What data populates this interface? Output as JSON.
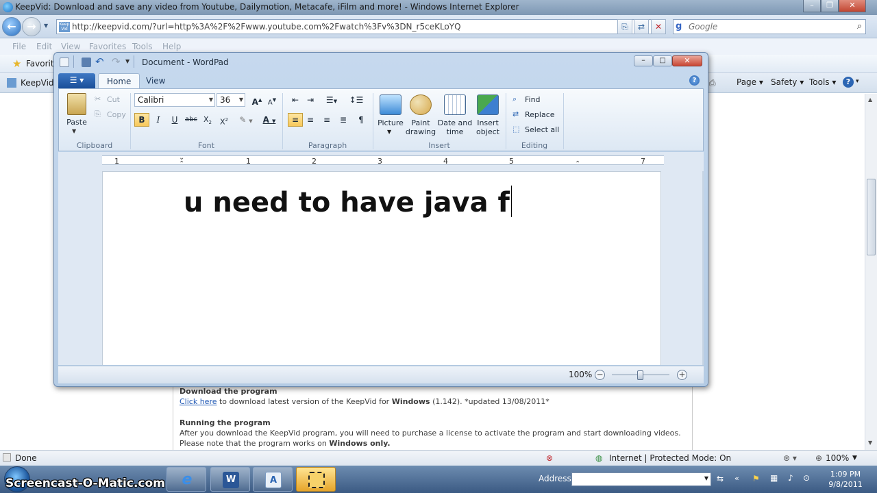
{
  "ie": {
    "title": "KeepVid: Download and save any video from Youtube, Dailymotion, Metacafe, iFilm and more! - Windows Internet Explorer",
    "address": "http://keepvid.com/?url=http%3A%2F%2Fwww.youtube.com%2Fwatch%3Fv%3DN_r5ceKLoYQ",
    "search_placeholder": "Google",
    "menu": [
      "File",
      "Edit",
      "View",
      "Favorites",
      "Tools",
      "Help"
    ],
    "favorites_label": "Favorit",
    "tab_label": "KeepVid",
    "commands": {
      "page": "Page",
      "safety": "Safety",
      "tools": "Tools"
    },
    "status": {
      "left": "Done",
      "zone": "Internet | Protected Mode: On",
      "zoom": "100%"
    }
  },
  "webpage": {
    "download_heading": "Download the program",
    "click_here": "Click here",
    "download_text": " to download latest version of the KeepVid for ",
    "download_os": "Windows",
    "download_version": " (1.142).  *updated 13/08/2011*",
    "running_heading": "Running the program",
    "running_text": "After you download the KeepVid program, you will need to purchase a license to activate the program and start downloading videos.",
    "note_text": "Please note that the program works on ",
    "note_os": "Windows only."
  },
  "wordpad": {
    "title": "Document - WordPad",
    "tabs": {
      "home": "Home",
      "view": "View"
    },
    "clipboard": {
      "paste": "Paste",
      "cut": "Cut",
      "copy": "Copy",
      "label": "Clipboard"
    },
    "font": {
      "family": "Calibri",
      "size": "36",
      "label": "Font"
    },
    "paragraph": {
      "label": "Paragraph"
    },
    "insert": {
      "picture": "Picture",
      "paint1": "Paint",
      "paint2": "drawing",
      "date1": "Date and",
      "date2": "time",
      "obj1": "Insert",
      "obj2": "object",
      "label": "Insert"
    },
    "editing": {
      "find": "Find",
      "replace": "Replace",
      "select_all": "Select all",
      "label": "Editing"
    },
    "ruler": [
      "1",
      "1",
      "2",
      "3",
      "4",
      "5",
      "7"
    ],
    "document_text": "u need to have java f",
    "zoom": "100%",
    "zoom_level": 0.5
  },
  "taskbar": {
    "address_label": "Address",
    "time": "1:09 PM",
    "date": "9/8/2011",
    "watermark": "Screencast-O-Matic.com"
  },
  "colors": {
    "ie_frame": "#9fb5cc",
    "ribbon": "#dde8f4",
    "bold_on": "#f7c85a",
    "link": "#1e57b4"
  }
}
